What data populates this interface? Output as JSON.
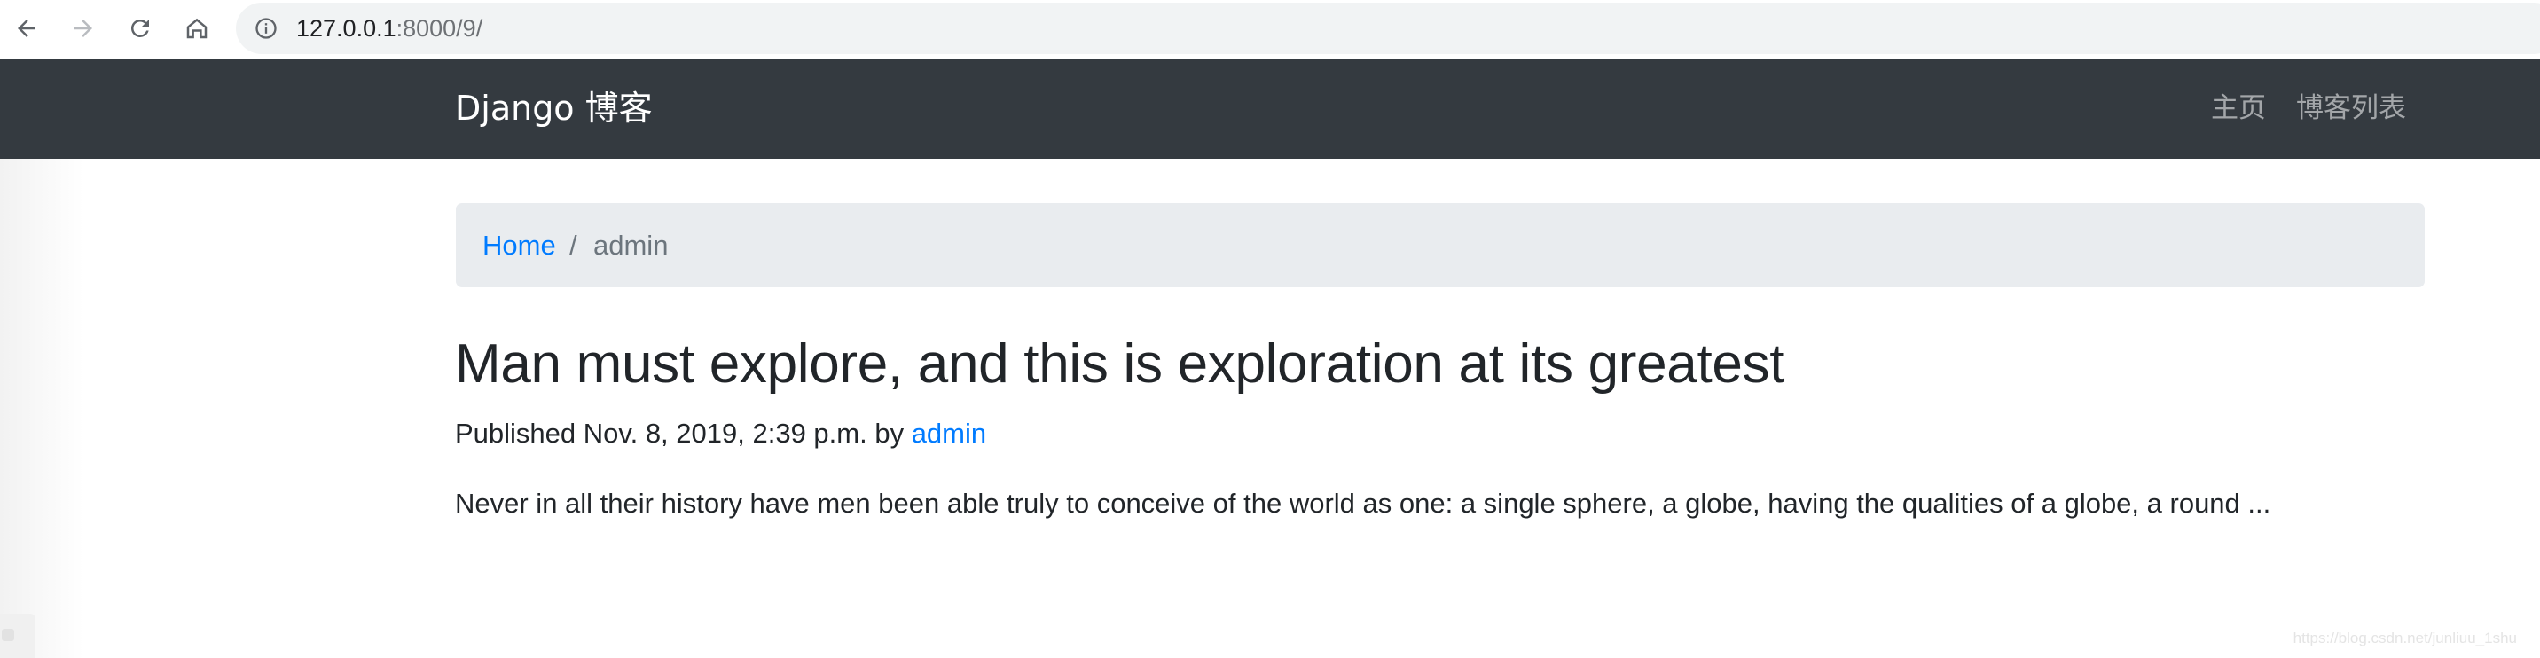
{
  "browser": {
    "url_host": "127.0.0.1",
    "url_rest": ":8000/9/",
    "icons": [
      "back-arrow-icon",
      "forward-arrow-icon",
      "reload-icon",
      "home-icon",
      "info-icon"
    ]
  },
  "navbar": {
    "brand": "Django 博客",
    "links": [
      {
        "label": "主页"
      },
      {
        "label": "博客列表"
      }
    ],
    "background": "#343a40"
  },
  "breadcrumb": {
    "home": "Home",
    "separator": "/",
    "current": "admin"
  },
  "post": {
    "title": "Man must explore, and this is exploration at its greatest",
    "meta_prefix": "Published Nov. 8, 2019, 2:39 p.m. by ",
    "author": "admin",
    "excerpt": "Never in all their history have men been able truly to conceive of the world as one: a single sphere, a globe, having the qualities of a globe, a round ..."
  },
  "watermark": "https://blog.csdn.net/junliuu_1shu",
  "colors": {
    "link": "#007bff",
    "text": "#212529",
    "muted": "#6c757d",
    "breadcrumb_bg": "#e9ecef"
  }
}
